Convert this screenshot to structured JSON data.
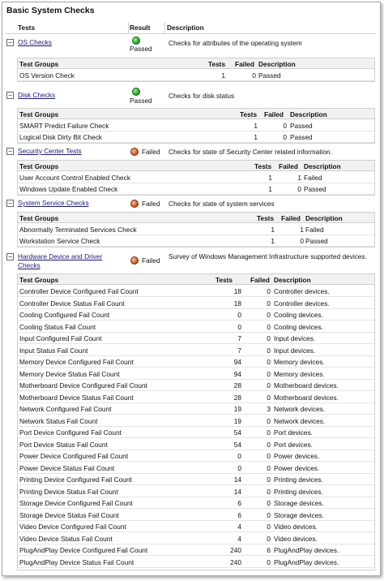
{
  "title": "Basic System Checks",
  "headers": {
    "tests": "Tests",
    "result": "Result",
    "description": "Description"
  },
  "group_headers": {
    "group": "Test Groups",
    "tests": "Tests",
    "failed": "Failed",
    "description": "Description"
  },
  "toggle_symbol": "−",
  "sections": [
    {
      "name": "OS Checks",
      "result": "Passed",
      "status": "passed",
      "description": "Checks for attributes of the operating system",
      "rows": [
        {
          "name": "OS Version Check",
          "tests": "1",
          "failed": "0",
          "desc": "Passed"
        }
      ]
    },
    {
      "name": "Disk Checks",
      "result": "Passed",
      "status": "passed",
      "description": "Checks for disk status",
      "rows": [
        {
          "name": "SMART Predict Failure Check",
          "tests": "1",
          "failed": "0",
          "desc": "Passed"
        },
        {
          "name": "Logical Disk Dirty Bit Check",
          "tests": "1",
          "failed": "0",
          "desc": "Passed"
        }
      ]
    },
    {
      "name": "Security Center Tests",
      "result": "Failed",
      "status": "failed",
      "description": "Checks for state of Security Center related information.",
      "rows": [
        {
          "name": "User Account Control Enabled Check",
          "tests": "1",
          "failed": "1",
          "desc": "Failed"
        },
        {
          "name": "Windows Update Enabled Check",
          "tests": "1",
          "failed": "0",
          "desc": "Passed"
        }
      ]
    },
    {
      "name": "System Service Checks",
      "result": "Failed",
      "status": "failed",
      "description": "Checks for state of system services",
      "rows": [
        {
          "name": "Abnormally Terminated Services Check",
          "tests": "1",
          "failed": "1",
          "desc": "Failed"
        },
        {
          "name": "Workstation Service Check",
          "tests": "1",
          "failed": "0",
          "desc": "Passed"
        }
      ]
    },
    {
      "name_line1": "Hardware Device and Driver",
      "name_line2": "Checks",
      "result": "Failed",
      "status": "failed",
      "description": "Survey of Windows Management Infrastructure supported devices.",
      "rows": [
        {
          "name": "Controller Device Configured Fail Count",
          "tests": "18",
          "failed": "0",
          "desc": "Controller devices."
        },
        {
          "name": "Controller Device Status Fail Count",
          "tests": "18",
          "failed": "0",
          "desc": "Controller devices."
        },
        {
          "name": "Cooling Configured Fail Count",
          "tests": "0",
          "failed": "0",
          "desc": "Cooling devices."
        },
        {
          "name": "Cooling Status Fail Count",
          "tests": "0",
          "failed": "0",
          "desc": "Cooling devices."
        },
        {
          "name": "Input Configured Fail Count",
          "tests": "7",
          "failed": "0",
          "desc": "Input devices."
        },
        {
          "name": "Input Status Fail Count",
          "tests": "7",
          "failed": "0",
          "desc": "Input devices."
        },
        {
          "name": "Memory Device Configured Fail Count",
          "tests": "94",
          "failed": "0",
          "desc": "Memory devices."
        },
        {
          "name": "Memory Device Status Fail Count",
          "tests": "94",
          "failed": "0",
          "desc": "Memory devices."
        },
        {
          "name": "Motherboard Device Configured Fail Count",
          "tests": "28",
          "failed": "0",
          "desc": "Motherboard devices."
        },
        {
          "name": "Motherboard Device Status Fail Count",
          "tests": "28",
          "failed": "0",
          "desc": "Motherboard devices."
        },
        {
          "name": "Network Configured Fail Count",
          "tests": "19",
          "failed": "3",
          "desc": "Network devices."
        },
        {
          "name": "Network Status Fail Count",
          "tests": "19",
          "failed": "0",
          "desc": "Network devices."
        },
        {
          "name": "Port Device Configured Fail Count",
          "tests": "54",
          "failed": "0",
          "desc": "Port devices."
        },
        {
          "name": "Port Device Status Fail Count",
          "tests": "54",
          "failed": "0",
          "desc": "Port devices."
        },
        {
          "name": "Power Device Configured Fail Count",
          "tests": "0",
          "failed": "0",
          "desc": "Power devices."
        },
        {
          "name": "Power Device Status Fail Count",
          "tests": "0",
          "failed": "0",
          "desc": "Power devices."
        },
        {
          "name": "Printing Device Configured Fail Count",
          "tests": "14",
          "failed": "0",
          "desc": "Printing devices."
        },
        {
          "name": "Printing Device Status Fail Count",
          "tests": "14",
          "failed": "0",
          "desc": "Printing devices."
        },
        {
          "name": "Storage Device Configured Fail Count",
          "tests": "6",
          "failed": "0",
          "desc": "Storage devices."
        },
        {
          "name": "Storage Device Status Fail Count",
          "tests": "6",
          "failed": "0",
          "desc": "Storage devices."
        },
        {
          "name": "Video Device Configured Fail Count",
          "tests": "4",
          "failed": "0",
          "desc": "Video devices."
        },
        {
          "name": "Video Device Status Fail Count",
          "tests": "4",
          "failed": "0",
          "desc": "Video devices."
        },
        {
          "name": "PlugAndPlay Device Configured Fail Count",
          "tests": "240",
          "failed": "6",
          "desc": "PlugAndPlay devices."
        },
        {
          "name": "PlugAndPlay Device Status Fail Count",
          "tests": "240",
          "failed": "0",
          "desc": "PlugAndPlay devices."
        }
      ]
    }
  ]
}
